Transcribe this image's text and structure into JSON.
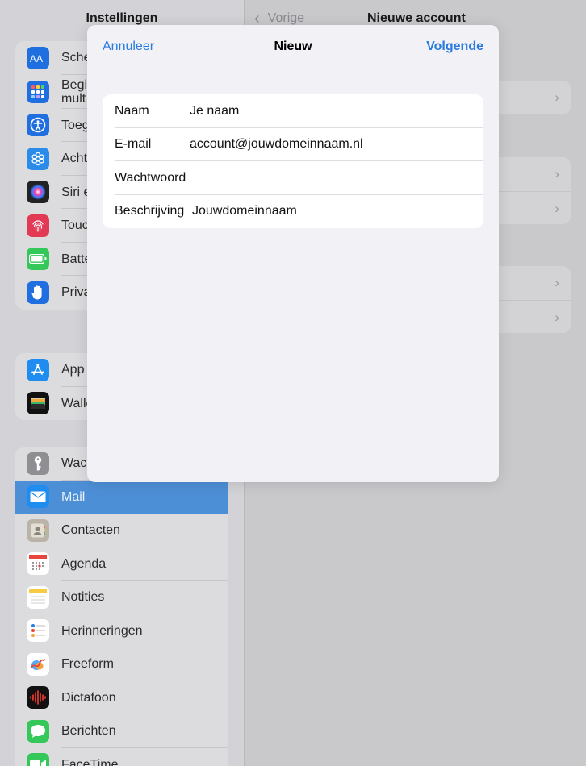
{
  "sidebar": {
    "title": "Instellingen",
    "groups": [
      {
        "items": [
          {
            "label": "Sche",
            "icon": "text-size-icon",
            "color": "#1f6fe0"
          },
          {
            "label": "Begi mult",
            "icon": "multitasking-icon",
            "color": "#1f6fe0"
          },
          {
            "label": "Toeg",
            "icon": "accessibility-icon",
            "color": "#1f6fe0"
          },
          {
            "label": "Acht",
            "icon": "wallpaper-icon",
            "color": "#2a8be8"
          },
          {
            "label": "Siri e",
            "icon": "siri-icon",
            "color": "#222222"
          },
          {
            "label": "Touc",
            "icon": "fingerprint-icon",
            "color": "#e23a55"
          },
          {
            "label": "Batte",
            "icon": "battery-icon",
            "color": "#34c759"
          },
          {
            "label": "Priva",
            "icon": "hand-icon",
            "color": "#1f6fe0"
          }
        ]
      },
      {
        "items": [
          {
            "label": "App",
            "icon": "app-store-icon",
            "color": "#1f8cf0"
          },
          {
            "label": "Walle",
            "icon": "wallet-icon",
            "color": "#111111"
          }
        ]
      },
      {
        "items": [
          {
            "label": "Wac",
            "icon": "key-icon",
            "color": "#8e8e93"
          },
          {
            "label": "Mail",
            "icon": "mail-icon",
            "color": "#1f8cf0",
            "active": true
          },
          {
            "label": "Contacten",
            "icon": "contacts-icon",
            "color": "#b9b3a8"
          },
          {
            "label": "Agenda",
            "icon": "calendar-icon",
            "color": "#ffffff"
          },
          {
            "label": "Notities",
            "icon": "notes-icon",
            "color": "#ffffff"
          },
          {
            "label": "Herinneringen",
            "icon": "reminders-icon",
            "color": "#ffffff"
          },
          {
            "label": "Freeform",
            "icon": "freeform-icon",
            "color": "#ffffff"
          },
          {
            "label": "Dictafoon",
            "icon": "voice-memos-icon",
            "color": "#111111"
          },
          {
            "label": "Berichten",
            "icon": "messages-icon",
            "color": "#34c759"
          },
          {
            "label": "FaceTime",
            "icon": "facetime-icon",
            "color": "#34c759"
          }
        ]
      }
    ]
  },
  "detail": {
    "back_label": "Vorige",
    "title": "Nieuwe account"
  },
  "modal": {
    "cancel_label": "Annuleer",
    "title": "Nieuw",
    "next_label": "Volgende",
    "fields": {
      "name": {
        "label": "Naam",
        "value": "",
        "placeholder": "Je naam"
      },
      "email": {
        "label": "E-mail",
        "value": "",
        "placeholder": "account@jouwdomeinnaam.nl"
      },
      "password": {
        "label": "Wachtwoord",
        "value": "",
        "placeholder": ""
      },
      "description": {
        "label": "Beschrijving",
        "value": "",
        "placeholder": "Jouwdomeinnaam"
      }
    }
  },
  "colors": {
    "accent": "#2a7be0",
    "selection": "#4d8fd6"
  }
}
